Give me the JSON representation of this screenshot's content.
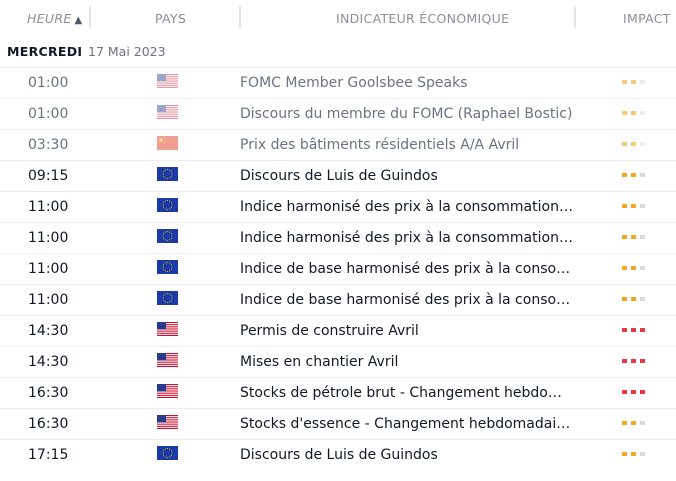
{
  "header": {
    "time": "HEURE",
    "sort_arrow": "▲",
    "country": "PAYS",
    "indicator": "INDICATEUR ÉCONOMIQUE",
    "impact": "IMPACT"
  },
  "day": {
    "name": "MERCREDI",
    "date": "17 Mai 2023"
  },
  "colors": {
    "orange": "#f5a623",
    "orange_dim": "#f7c97a",
    "red": "#e63946",
    "grey": "#d7dadf",
    "grey_dim": "#ebedf0"
  },
  "rows": [
    {
      "time": "01:00",
      "country": "us",
      "country_icon": "us-flag-icon",
      "name": "FOMC Member Goolsbee Speaks",
      "impact": 2,
      "past": true
    },
    {
      "time": "01:00",
      "country": "us",
      "country_icon": "us-flag-icon",
      "name": "Discours du membre du FOMC (Raphael Bostic)",
      "impact": 2,
      "past": true
    },
    {
      "time": "03:30",
      "country": "cn",
      "country_icon": "china-flag-icon",
      "name": "Prix des bâtiments résidentiels A/A Avril",
      "impact": 2,
      "past": true
    },
    {
      "time": "09:15",
      "country": "eu",
      "country_icon": "eu-flag-icon",
      "name": "Discours de Luis de Guindos",
      "impact": 2,
      "past": false
    },
    {
      "time": "11:00",
      "country": "eu",
      "country_icon": "eu-flag-icon",
      "name": "Indice harmonisé des prix à la consommation (HICP) M/M",
      "impact": 2,
      "past": false
    },
    {
      "time": "11:00",
      "country": "eu",
      "country_icon": "eu-flag-icon",
      "name": "Indice harmonisé des prix à la consommation (HICP) A/A",
      "impact": 2,
      "past": false
    },
    {
      "time": "11:00",
      "country": "eu",
      "country_icon": "eu-flag-icon",
      "name": "Indice de base harmonisé des prix à la consommation M/M",
      "impact": 2,
      "past": false
    },
    {
      "time": "11:00",
      "country": "eu",
      "country_icon": "eu-flag-icon",
      "name": "Indice de base harmonisé des prix à la consommation A/A",
      "impact": 2,
      "past": false
    },
    {
      "time": "14:30",
      "country": "us",
      "country_icon": "us-flag-icon",
      "name": "Permis de construire Avril",
      "impact": 3,
      "past": false
    },
    {
      "time": "14:30",
      "country": "us",
      "country_icon": "us-flag-icon",
      "name": "Mises en chantier Avril",
      "impact": 3,
      "past": false
    },
    {
      "time": "16:30",
      "country": "us",
      "country_icon": "us-flag-icon",
      "name": "Stocks de pétrole brut - Changement hebdomadaire",
      "impact": 3,
      "past": false
    },
    {
      "time": "16:30",
      "country": "us",
      "country_icon": "us-flag-icon",
      "name": "Stocks d'essence - Changement hebdomadaire (EIA)",
      "impact": 2,
      "past": false
    },
    {
      "time": "17:15",
      "country": "eu",
      "country_icon": "eu-flag-icon",
      "name": "Discours de Luis de Guindos",
      "impact": 2,
      "past": false
    }
  ]
}
